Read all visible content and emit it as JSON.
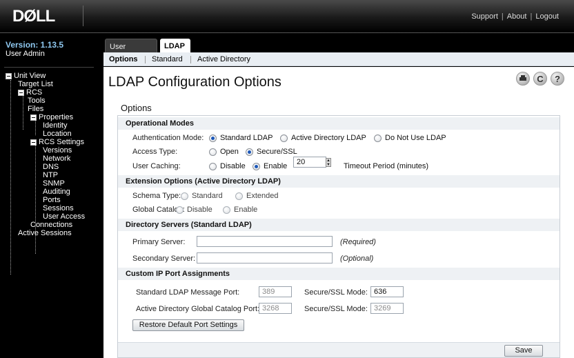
{
  "header": {
    "logo": "DØLL",
    "links": [
      "Support",
      "About",
      "Logout"
    ]
  },
  "sidebar": {
    "version": "Version: 1.13.5",
    "user": "User Admin",
    "tree": [
      "Unit View",
      "Target List",
      "RCS",
      "Tools",
      "Files",
      "Properties",
      "Identity",
      "Location",
      "RCS Settings",
      "Versions",
      "Network",
      "DNS",
      "NTP",
      "SNMP",
      "Auditing",
      "Ports",
      "Sessions",
      "User Access",
      "Connections",
      "Active Sessions"
    ]
  },
  "tabs": [
    "User Accounts",
    "LDAP"
  ],
  "subtabs": [
    "Options",
    "Standard",
    "Active Directory"
  ],
  "page": {
    "title": "LDAP Configuration Options",
    "section": "Options"
  },
  "operational": {
    "header": "Operational Modes",
    "auth_label": "Authentication Mode:",
    "auth_options": [
      "Standard LDAP",
      "Active Directory LDAP",
      "Do Not Use LDAP"
    ],
    "access_label": "Access Type:",
    "access_options": [
      "Open",
      "Secure/SSL"
    ],
    "caching_label": "User Caching:",
    "caching_options": [
      "Disable",
      "Enable"
    ],
    "timeout_value": "20",
    "timeout_label": "Timeout Period (minutes)"
  },
  "extension": {
    "header": "Extension Options (Active Directory LDAP)",
    "schema_label": "Schema Type:",
    "schema_options": [
      "Standard",
      "Extended"
    ],
    "catalog_label": "Global Catalog:",
    "catalog_options": [
      "Disable",
      "Enable"
    ]
  },
  "directory": {
    "header": "Directory Servers (Standard LDAP)",
    "primary_label": "Primary Server:",
    "primary_value": "",
    "primary_hint": "(Required)",
    "secondary_label": "Secondary Server:",
    "secondary_value": "",
    "secondary_hint": "(Optional)"
  },
  "ports": {
    "header": "Custom IP Port Assignments",
    "std_label": "Standard LDAP Message Port:",
    "std_value": "389",
    "std_ssl_label": "Secure/SSL Mode:",
    "std_ssl_value": "636",
    "ad_label": "Active Directory Global Catalog Port:",
    "ad_value": "3268",
    "ad_ssl_label": "Secure/SSL Mode:",
    "ad_ssl_value": "3269",
    "restore_button": "Restore Default Port Settings"
  },
  "save_button": "Save"
}
